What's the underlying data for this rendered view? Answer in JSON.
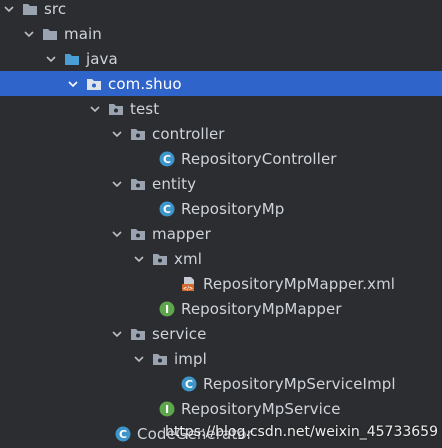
{
  "tree": {
    "src": "src",
    "main": "main",
    "java": "java",
    "com_shuo": "com.shuo",
    "test": "test",
    "controller": "controller",
    "repository_controller": "RepositoryController",
    "entity": "entity",
    "repository_mp": "RepositoryMp",
    "mapper": "mapper",
    "xml": "xml",
    "mapper_xml": "RepositoryMpMapper.xml",
    "mapper_iface": "RepositoryMpMapper",
    "service": "service",
    "impl": "impl",
    "service_impl": "RepositoryMpServiceImpl",
    "service_iface": "RepositoryMpService",
    "code_generator": "CodeGenerator"
  },
  "watermark": "https://blog.csdn.net/weixin_45733659",
  "colors": {
    "background": "#2b2d30",
    "selection": "#2f65ca",
    "folder": "#9aa3b0",
    "source_folder": "#4a9fd6",
    "class_badge": "#3d95c9",
    "interface_badge": "#5ea64b",
    "xml_badge": "#d46b2c"
  }
}
